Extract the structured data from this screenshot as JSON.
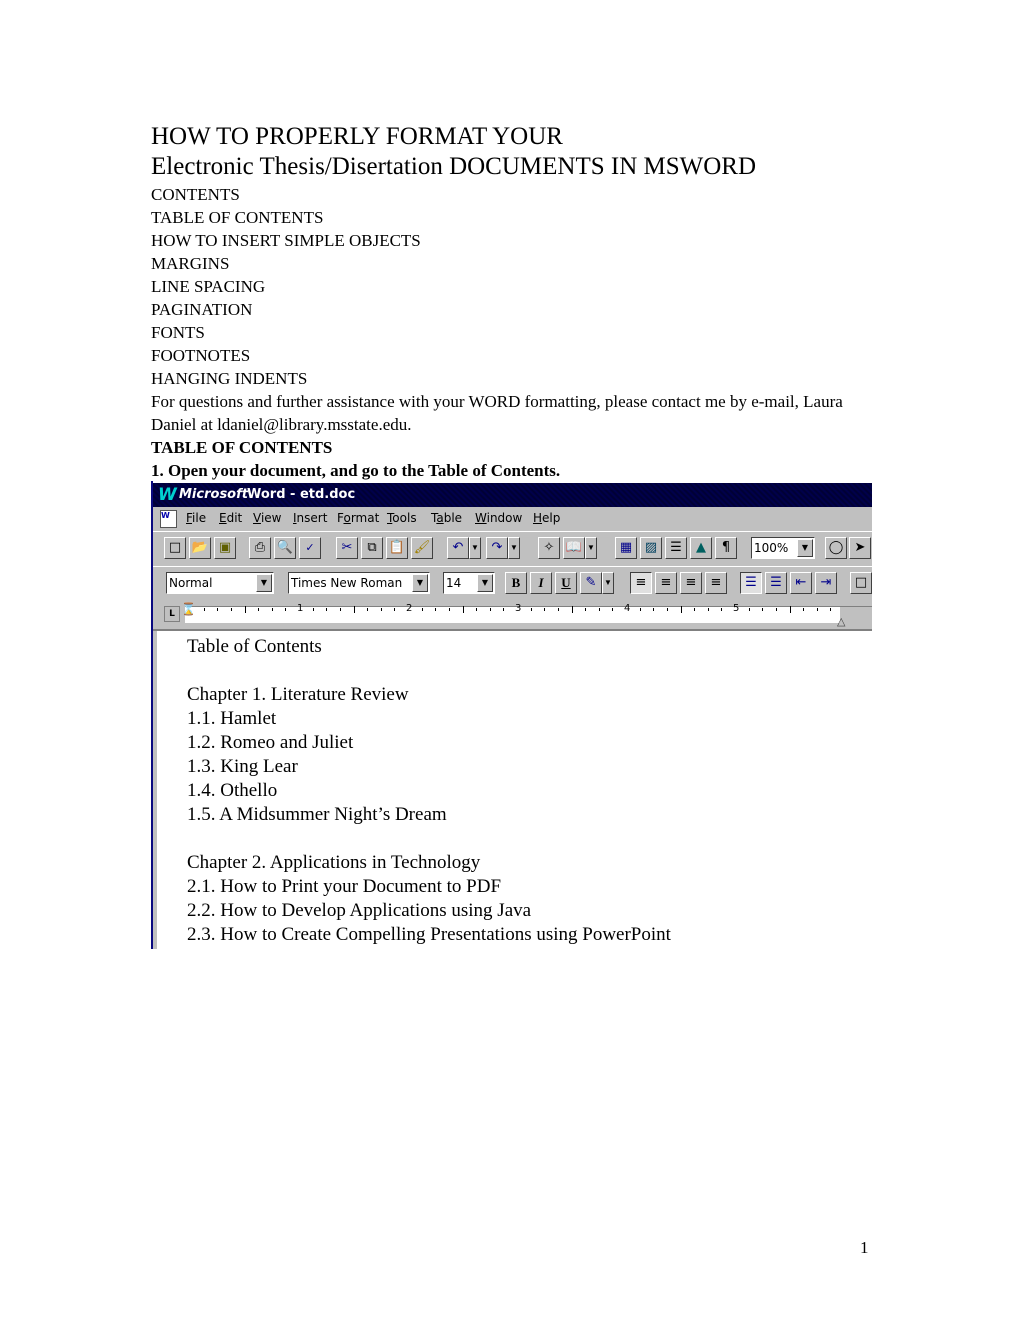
{
  "document": {
    "title_line1": "HOW TO PROPERLY FORMAT YOUR",
    "title_line2": "Electronic Thesis/Disertation DOCUMENTS IN MSWORD",
    "contents_list": [
      "CONTENTS",
      "TABLE OF CONTENTS",
      "HOW TO INSERT SIMPLE OBJECTS",
      "MARGINS",
      "LINE SPACING",
      "PAGINATION",
      "FONTS",
      "FOOTNOTES",
      "HANGING INDENTS"
    ],
    "contact_text": "For questions and further assistance with your WORD formatting, please contact me by e-mail, Laura Daniel at ldaniel@library.msstate.edu.",
    "section_heading": "TABLE OF CONTENTS",
    "step1": "1. Open your document, and go to the Table of Contents.",
    "page_number": "1"
  },
  "word_window": {
    "title_logo": "W",
    "title_brand": "Microsoft",
    "title_rest": "Word - etd.doc",
    "menu": [
      {
        "pre": "",
        "key": "F",
        "post": "ile"
      },
      {
        "pre": "",
        "key": "E",
        "post": "dit"
      },
      {
        "pre": "",
        "key": "V",
        "post": "iew"
      },
      {
        "pre": "",
        "key": "I",
        "post": "nsert"
      },
      {
        "pre": "F",
        "key": "o",
        "post": "rmat"
      },
      {
        "pre": "",
        "key": "T",
        "post": "ools"
      },
      {
        "pre": "T",
        "key": "a",
        "post": "ble"
      },
      {
        "pre": "",
        "key": "W",
        "post": "indow"
      },
      {
        "pre": "",
        "key": "H",
        "post": "elp"
      }
    ],
    "standard_toolbar": {
      "icons": [
        "new-document",
        "open",
        "save",
        "print",
        "print-preview",
        "spelling",
        "cut",
        "copy",
        "paste",
        "format-painter",
        "undo",
        "redo",
        "insert-address",
        "insert-hyperlink",
        "tables-and-borders",
        "insert-table",
        "insert-excel",
        "columns",
        "drawing",
        "show-hide",
        "office-assistant",
        "help-pointer"
      ],
      "zoom_value": "100%"
    },
    "formatting_toolbar": {
      "style_value": "Normal",
      "font_value": "Times New Roman",
      "size_value": "14",
      "bold_label": "B",
      "italic_label": "I",
      "underline_label": "U",
      "pilcrow": "¶"
    },
    "ruler": {
      "tab_selector": "L",
      "numbers": [
        "1",
        "2",
        "3",
        "4",
        "5"
      ]
    },
    "doc_content": [
      "Table of Contents",
      "",
      "Chapter 1.  Literature Review",
      "1.1. Hamlet",
      "1.2. Romeo and Juliet",
      "1.3. King Lear",
      "1.4. Othello",
      "1.5. A Midsummer Night’s Dream",
      "",
      "Chapter 2.  Applications in Technology",
      "2.1. How to Print your Document to PDF",
      "2.2. How to Develop Applications using Java",
      "2.3. How to Create Compelling Presentations using PowerPoint"
    ]
  }
}
